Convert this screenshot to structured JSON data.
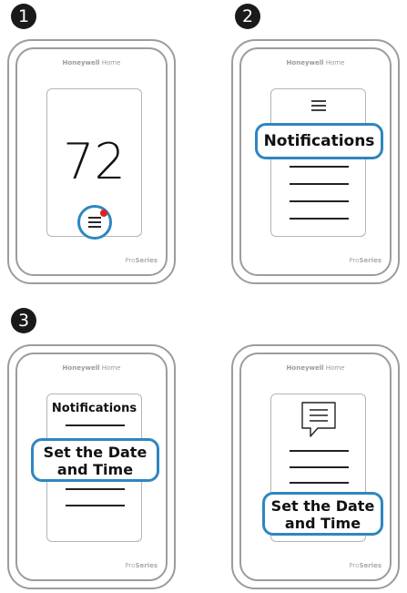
{
  "steps": [
    "1",
    "2",
    "3"
  ],
  "device": {
    "brand_bold": "Honeywell",
    "brand_light": " Home",
    "series_light": "Pro",
    "series_bold": "Series"
  },
  "panel1": {
    "temperature": "72"
  },
  "panel2": {
    "callout": "Notifications"
  },
  "panel3": {
    "screen_title": "Notifications",
    "callout_line1": "Set the Date",
    "callout_line2": "and Time"
  },
  "panel4": {
    "callout_line1": "Set the Date",
    "callout_line2": "and Time"
  },
  "colors": {
    "accent": "#2e86c1",
    "alert": "#e02020",
    "frame": "#9c9c9c"
  },
  "icons": [
    "menu-icon",
    "notification-dot-icon",
    "message-bubble-icon"
  ]
}
